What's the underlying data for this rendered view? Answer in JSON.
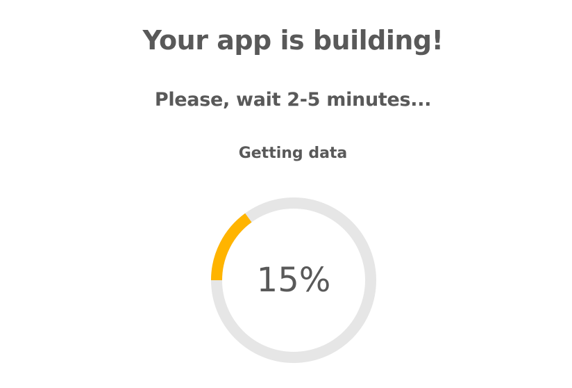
{
  "header": {
    "title": "Your app is building!",
    "subtitle": "Please, wait 2-5 minutes...",
    "step": "Getting data"
  },
  "progress": {
    "value": 15,
    "label": "15%",
    "track_color": "#e6e6e6",
    "fill_color": "#ffb400"
  }
}
